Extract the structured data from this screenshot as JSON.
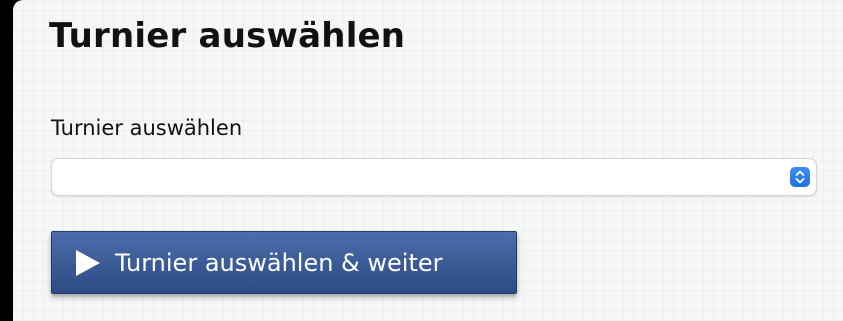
{
  "page": {
    "title": "Turnier auswählen"
  },
  "form": {
    "label": "Turnier auswählen",
    "select": {
      "selected_value": "",
      "icon": "select-arrows-icon",
      "accent_color": "#2a7ef0"
    },
    "submit": {
      "label": "Turnier auswählen & weiter",
      "icon": "play-icon",
      "color": "#3a5a96"
    }
  }
}
